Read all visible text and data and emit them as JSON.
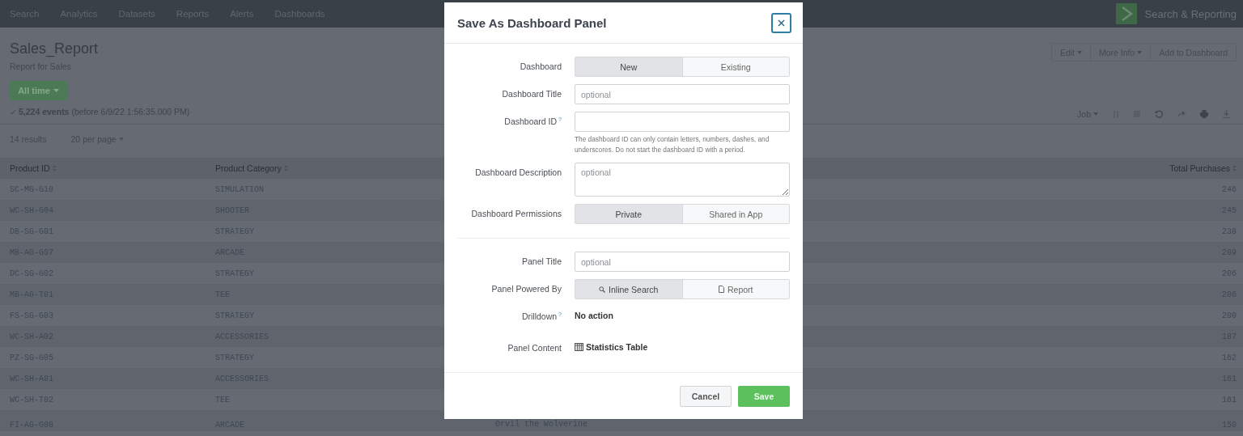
{
  "nav": {
    "items": [
      "Search",
      "Analytics",
      "Datasets",
      "Reports",
      "Alerts",
      "Dashboards"
    ],
    "app_name": "Search & Reporting"
  },
  "report": {
    "title": "Sales_Report",
    "description": "Report for Sales",
    "time_button": "All time",
    "events": "**5,224 events** (before 6/9/22 1:56:35.000 PM)",
    "actions": [
      {
        "label": "Edit",
        "menu": true
      },
      {
        "label": "More Info",
        "menu": true
      },
      {
        "label": "Add to Dashboard",
        "menu": false
      }
    ],
    "job_menu": "Job"
  },
  "results": {
    "count": "14 results",
    "per_page": "20 per page"
  },
  "table": {
    "columns": [
      "Product ID",
      "Product Category",
      "Total Purchases"
    ],
    "rows": [
      {
        "id": "SC-MG-G10",
        "category": "SIMULATION",
        "total": "246"
      },
      {
        "id": "WC-SH-G04",
        "category": "SHOOTER",
        "total": "245"
      },
      {
        "id": "DB-SG-G01",
        "category": "STRATEGY",
        "total": "238"
      },
      {
        "id": "MB-AG-G07",
        "category": "ARCADE",
        "total": "209"
      },
      {
        "id": "DC-SG-G02",
        "category": "STRATEGY",
        "total": "206"
      },
      {
        "id": "MB-AG-T01",
        "category": "TEE",
        "total": "206"
      },
      {
        "id": "FS-SG-G03",
        "category": "STRATEGY",
        "total": "200"
      },
      {
        "id": "WC-SH-A02",
        "category": "ACCESSORIES",
        "total": "187"
      },
      {
        "id": "PZ-SG-G05",
        "category": "STRATEGY",
        "total": "162"
      },
      {
        "id": "WC-SH-A01",
        "category": "ACCESSORIES",
        "total": "161"
      },
      {
        "id": "WC-SH-T02",
        "category": "TEE",
        "total": "161"
      },
      {
        "id": "FI-AG-G08",
        "category": "ARCADE",
        "column_3": "Orvil the Wolverine",
        "total": "150"
      }
    ]
  },
  "modal": {
    "title": "Save As Dashboard Panel",
    "fields": [
      {
        "kind": "segmented",
        "label": "Dashboard",
        "options": [
          {
            "label": "New",
            "selected": true
          },
          {
            "label": "Existing",
            "selected": false
          }
        ]
      },
      {
        "kind": "input",
        "label": "Dashboard Title",
        "placeholder": "optional"
      },
      {
        "kind": "input",
        "label": "Dashboard ID",
        "help_mark": "?",
        "help": "The dashboard ID can only contain letters, numbers, dashes, and underscores. Do not start the dashboard ID with a period."
      },
      {
        "kind": "textarea",
        "label": "Dashboard Description",
        "placeholder": "optional"
      },
      {
        "kind": "segmented",
        "label": "Dashboard Permissions",
        "options": [
          {
            "label": "Private",
            "selected": true
          },
          {
            "label": "Shared in App",
            "selected": false
          }
        ]
      },
      {
        "kind": "divider"
      },
      {
        "kind": "input",
        "label": "Panel Title",
        "placeholder": "optional"
      },
      {
        "kind": "segmented",
        "label": "Panel Powered By",
        "with_icons": true,
        "options": [
          {
            "label": "Inline Search",
            "selected": true
          },
          {
            "label": "Report",
            "selected": false
          }
        ]
      },
      {
        "kind": "value",
        "label": "Drilldown",
        "help_mark": "?",
        "value": "No action"
      },
      {
        "kind": "value",
        "label": "Panel Content",
        "with_icon": true,
        "value": "Statistics Table"
      }
    ],
    "buttons": [
      {
        "label": "Cancel",
        "kind": "secondary"
      },
      {
        "label": "Save",
        "kind": "primary"
      }
    ]
  }
}
